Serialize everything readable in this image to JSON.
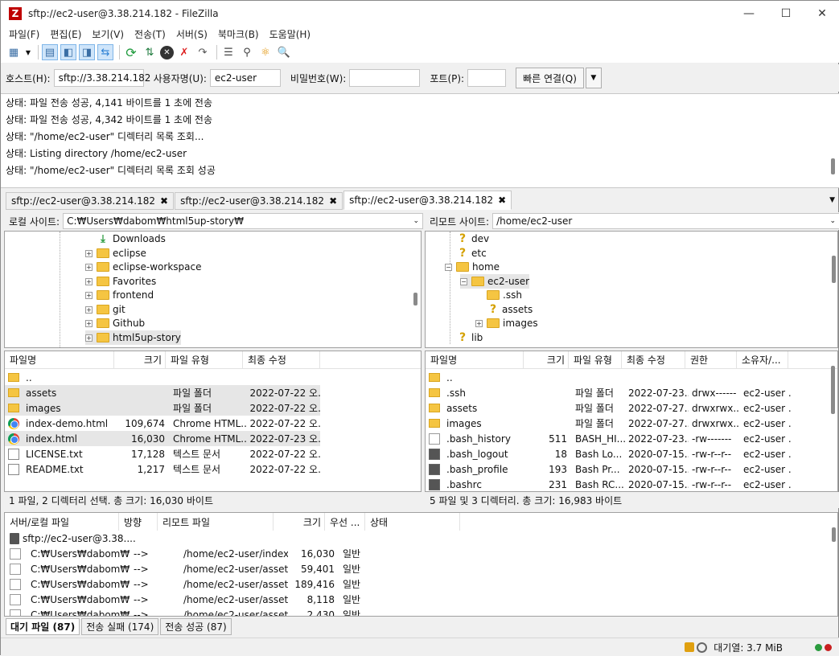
{
  "window": {
    "title": "sftp://ec2-user@3.38.214.182 - FileZilla",
    "icon_letter": "Z"
  },
  "menu": [
    "파일(F)",
    "편집(E)",
    "보기(V)",
    "전송(T)",
    "서버(S)",
    "북마크(B)",
    "도움말(H)"
  ],
  "quickconnect": {
    "host_label": "호스트(H):",
    "host_value": "sftp://3.38.214.182",
    "user_label": "사용자명(U):",
    "user_value": "ec2-user",
    "pass_label": "비밀번호(W):",
    "pass_value": "",
    "port_label": "포트(P):",
    "port_value": "",
    "connect_label": "빠른 연결(Q)"
  },
  "log": [
    "상태:  파일 전송 성공, 4,141 바이트를 1 초에 전송",
    "상태:  파일 전송 성공, 4,342 바이트를 1 초에 전송",
    "상태:  \"/home/ec2-user\" 디렉터리 목록 조회...",
    "상태:  Listing directory /home/ec2-user",
    "상태:  \"/home/ec2-user\" 디렉터리 목록 조회 성공"
  ],
  "tabs": [
    "sftp://ec2-user@3.38.214.182",
    "sftp://ec2-user@3.38.214.182",
    "sftp://ec2-user@3.38.214.182"
  ],
  "local": {
    "site_label": "로컬 사이트:",
    "path": "C:₩Users₩dabom₩html5up-story₩",
    "tree": [
      "Downloads",
      "eclipse",
      "eclipse-workspace",
      "Favorites",
      "frontend",
      "git",
      "Github",
      "html5up-story"
    ],
    "headers": [
      "파일명",
      "크기",
      "파일 유형",
      "최종 수정"
    ],
    "files": [
      {
        "name": "..",
        "size": "",
        "type": "",
        "date": ""
      },
      {
        "name": "assets",
        "size": "",
        "type": "파일 폴더",
        "date": "2022-07-22 오..."
      },
      {
        "name": "images",
        "size": "",
        "type": "파일 폴더",
        "date": "2022-07-22 오..."
      },
      {
        "name": "index-demo.html",
        "size": "109,674",
        "type": "Chrome HTML...",
        "date": "2022-07-22 오..."
      },
      {
        "name": "index.html",
        "size": "16,030",
        "type": "Chrome HTML...",
        "date": "2022-07-23 오..."
      },
      {
        "name": "LICENSE.txt",
        "size": "17,128",
        "type": "텍스트 문서",
        "date": "2022-07-22 오..."
      },
      {
        "name": "README.txt",
        "size": "1,217",
        "type": "텍스트 문서",
        "date": "2022-07-22 오..."
      }
    ],
    "status": "1 파일, 2 디렉터리 선택. 총 크기: 16,030 바이트"
  },
  "remote": {
    "site_label": "리모트 사이트:",
    "path": "/home/ec2-user",
    "tree": [
      "dev",
      "etc",
      "home",
      "ec2-user",
      ".ssh",
      "assets",
      "images",
      "lib"
    ],
    "headers": [
      "파일명",
      "크기",
      "파일 유형",
      "최종 수정",
      "권한",
      "소유자/..."
    ],
    "files": [
      {
        "name": "..",
        "size": "",
        "type": "",
        "date": "",
        "perm": "",
        "owner": ""
      },
      {
        "name": ".ssh",
        "size": "",
        "type": "파일 폴더",
        "date": "2022-07-23...",
        "perm": "drwx------",
        "owner": "ec2-user ..."
      },
      {
        "name": "assets",
        "size": "",
        "type": "파일 폴더",
        "date": "2022-07-27...",
        "perm": "drwxrwx...",
        "owner": "ec2-user ..."
      },
      {
        "name": "images",
        "size": "",
        "type": "파일 폴더",
        "date": "2022-07-27...",
        "perm": "drwxrwx...",
        "owner": "ec2-user ..."
      },
      {
        "name": ".bash_history",
        "size": "511",
        "type": "BASH_HI...",
        "date": "2022-07-23...",
        "perm": "-rw-------",
        "owner": "ec2-user ..."
      },
      {
        "name": ".bash_logout",
        "size": "18",
        "type": "Bash Lo...",
        "date": "2020-07-15...",
        "perm": "-rw-r--r--",
        "owner": "ec2-user ..."
      },
      {
        "name": ".bash_profile",
        "size": "193",
        "type": "Bash Pr...",
        "date": "2020-07-15...",
        "perm": "-rw-r--r--",
        "owner": "ec2-user ..."
      },
      {
        "name": ".bashrc",
        "size": "231",
        "type": "Bash RC...",
        "date": "2020-07-15...",
        "perm": "-rw-r--r--",
        "owner": "ec2-user ..."
      }
    ],
    "status": "5 파일 및 3 디렉터리. 총 크기: 16,983 바이트"
  },
  "queue": {
    "headers": [
      "서버/로컬 파일",
      "방향",
      "리모트 파일",
      "크기",
      "우선 ...",
      "상태"
    ],
    "server": "sftp://ec2-user@3.38....",
    "rows": [
      {
        "local": "C:₩Users₩dabom₩...",
        "dir": "-->",
        "remote": "/home/ec2-user/index....",
        "size": "16,030",
        "prio": "일반"
      },
      {
        "local": "C:₩Users₩dabom₩...",
        "dir": "-->",
        "remote": "/home/ec2-user/assets/...",
        "size": "59,401",
        "prio": "일반"
      },
      {
        "local": "C:₩Users₩dabom₩...",
        "dir": "-->",
        "remote": "/home/ec2-user/assets/...",
        "size": "189,416",
        "prio": "일반"
      },
      {
        "local": "C:₩Users₩dabom₩...",
        "dir": "-->",
        "remote": "/home/ec2-user/assets/...",
        "size": "8,118",
        "prio": "일반"
      },
      {
        "local": "C:₩Users₩dabom₩...",
        "dir": "-->",
        "remote": "/home/ec2-user/assets/...",
        "size": "2,430",
        "prio": "일반"
      }
    ],
    "tabs": [
      "대기 파일 (87)",
      "전송 실패 (174)",
      "전송 성공 (87)"
    ]
  },
  "statusbar": {
    "queue": "대기열: 3.7 MiB"
  }
}
